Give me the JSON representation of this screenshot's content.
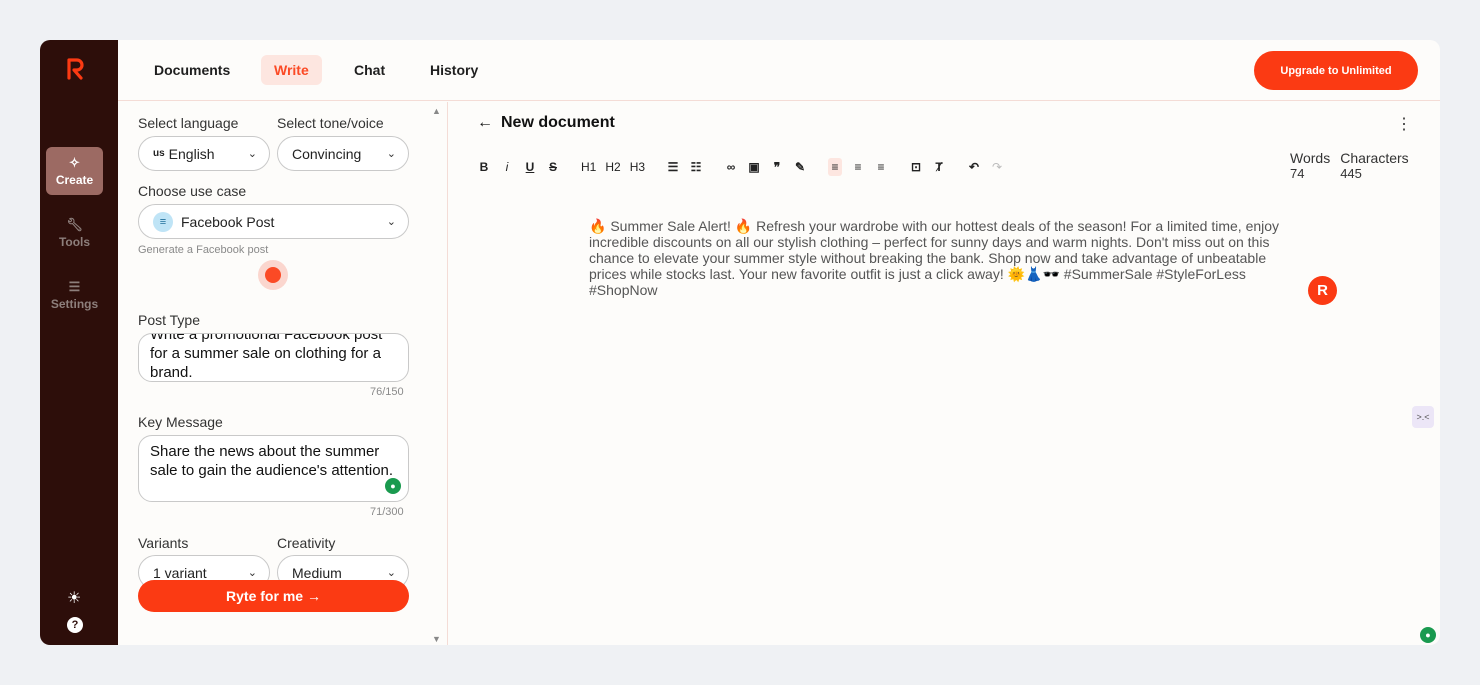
{
  "sidebar": {
    "items": [
      {
        "label": "Create",
        "icon": "sparkle-icon"
      },
      {
        "label": "Tools",
        "icon": "wrench-icon"
      },
      {
        "label": "Settings",
        "icon": "sliders-icon"
      }
    ],
    "bottom_icons": [
      "sun-icon",
      "help-icon"
    ]
  },
  "nav": {
    "tabs": [
      {
        "label": "Documents"
      },
      {
        "label": "Write"
      },
      {
        "label": "Chat"
      },
      {
        "label": "History"
      }
    ],
    "upgrade_label": "Upgrade to Unlimited"
  },
  "form": {
    "language_label": "Select language",
    "language_flag": "us",
    "language_value": "English",
    "tone_label": "Select tone/voice",
    "tone_value": "Convincing",
    "use_case_label": "Choose use case",
    "use_case_value": "Facebook Post",
    "use_case_hint": "Generate a Facebook post",
    "post_type_label": "Post Type",
    "post_type_value": "Write a promotional Facebook post for a summer sale on clothing for a brand.",
    "post_type_count": "76/150",
    "key_message_label": "Key Message",
    "key_message_value": "Share the news about the summer sale to gain the audience's attention.",
    "key_message_count": "71/300",
    "variants_label": "Variants",
    "variants_value": "1 variant",
    "creativity_label": "Creativity",
    "creativity_value": "Medium",
    "submit_label": "Ryte for me →"
  },
  "editor": {
    "title": "New document",
    "toolbar": {
      "text": [
        "B",
        "i",
        "U",
        "S"
      ],
      "headings": [
        "H1",
        "H2",
        "H3"
      ]
    },
    "words_label": "Words",
    "words_value": "74",
    "chars_label": "Characters",
    "chars_value": "445",
    "content": "🔥 Summer Sale Alert! 🔥 Refresh your wardrobe with our hottest deals of the season! For a limited time, enjoy incredible discounts on all our stylish clothing – perfect for sunny days and warm nights. Don't miss out on this chance to elevate your summer style without breaking the bank. Shop now and take advantage of unbeatable prices while stocks last. Your new favorite outfit is just a click away! 🌞👗🕶️ #SummerSale #StyleForLess #ShopNow"
  },
  "colors": {
    "accent": "#fb3a13",
    "sidebar_bg": "#2d0e0a",
    "active_tab_bg": "#fde6e0"
  }
}
